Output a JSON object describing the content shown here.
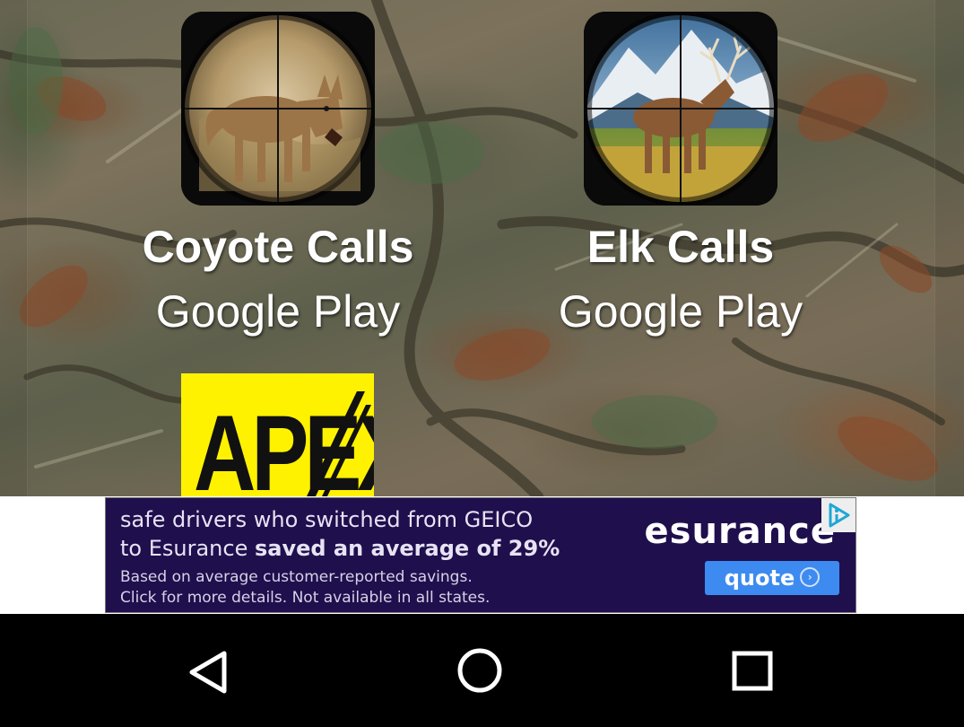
{
  "apps": [
    {
      "name": "Coyote Calls",
      "store": "Google Play",
      "icon": "coyote-scope-icon"
    },
    {
      "name": "Elk Calls",
      "store": "Google Play",
      "icon": "elk-scope-icon"
    }
  ],
  "apex": {
    "text": "APEX",
    "icon": "apex-logo"
  },
  "ad": {
    "line1": "safe drivers who switched from GEICO",
    "line2_prefix": "to Esurance ",
    "line2_bold": "saved an average of 29%",
    "disclaimer1": "Based on average customer-reported savings.",
    "disclaimer2": "Click for more details. Not available in all states.",
    "brand": "esurance",
    "cta": "quote",
    "adchoices_icon": "adchoices-icon"
  },
  "navbar": {
    "back_icon": "back-triangle-icon",
    "home_icon": "home-circle-icon",
    "recents_icon": "recents-square-icon"
  },
  "colors": {
    "ad_background": "#1f0f4d",
    "ad_button": "#3d8bf0",
    "apex_yellow": "#fff200",
    "navbar": "#000000"
  }
}
